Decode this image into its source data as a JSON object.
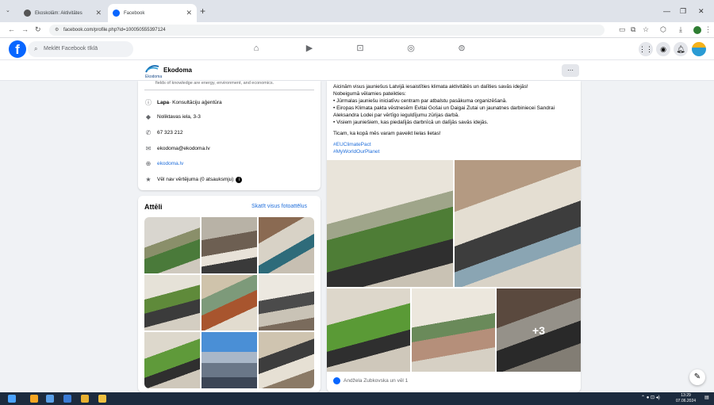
{
  "browser": {
    "tabs": [
      {
        "label": "Ekoskolām: Aktivitātes",
        "active": false
      },
      {
        "label": "Facebook",
        "active": true
      }
    ],
    "url": "facebook.com/profile.php?id=100050555397124",
    "icons": [
      "back-icon",
      "forward-icon",
      "reload-icon",
      "site-info-icon",
      "cast-icon",
      "translate-icon",
      "star-icon",
      "extensions-icon",
      "download-icon",
      "profile-icon",
      "menu-icon"
    ]
  },
  "facebook": {
    "search_placeholder": "Meklēt Facebook tīklā",
    "nav_icons": [
      "home-icon",
      "video-icon",
      "marketplace-icon",
      "groups-icon",
      "gaming-icon"
    ],
    "right_icons": [
      "apps-grid-icon",
      "messenger-icon",
      "notifications-icon",
      "account-avatar"
    ]
  },
  "page": {
    "name": "Ekodoma",
    "logo_text": "Ekodoma",
    "more_label": "···"
  },
  "intro": {
    "faded_text": "fields of knowledge are energy, environment, and economics.",
    "rows": [
      {
        "icon": "info-icon",
        "label": "Lapa",
        "value": " · Konsultāciju aģentūra"
      },
      {
        "icon": "location-icon",
        "value": "Noliktavas iela, 3-3"
      },
      {
        "icon": "phone-icon",
        "value": "67 323 212"
      },
      {
        "icon": "email-icon",
        "value": "ekodoma@ekodoma.lv"
      },
      {
        "icon": "web-icon",
        "value": "ekodoma.lv"
      },
      {
        "icon": "star-icon",
        "value": "Vēl nav vērtējuma (0 atsauksmju)"
      }
    ]
  },
  "photos": {
    "title": "Attēli",
    "see_all": "Skatīt visus fotoattēlus"
  },
  "post": {
    "lines": [
      "Aicinām visus jauniešus Latvijā iesaistīties klimata aktivitātēs un dalīties savās idejās!",
      "Nobeigumā vēlamies pateikties:",
      "• Jūrmalas jauniešu iniciatīvu centram par atbalstu pasākuma organizēšanā.",
      "• Eiropas Klimata pakta vēstnesēm Evitai Gošai un Daigai Zutai un jaunatnes darbiniecei Sandrai",
      "Aleksandra Lodei par vērtīgo ieguldījumu zūrijas darbā.",
      "• Visiem jauniešiem, kas piedalījās darbnīcā un dalījās savās idejās.",
      "Ticam, ka kopā mēs varam paveikt lielas lietas!"
    ],
    "hashtags": [
      "#EUClimatePact",
      "#MyWorldOurPlanet"
    ],
    "more_photos": "+3",
    "reactions": "Andžela Zubkovska un vēl 1"
  },
  "taskbar": {
    "time": "13:29",
    "date": "07.06.2024"
  }
}
